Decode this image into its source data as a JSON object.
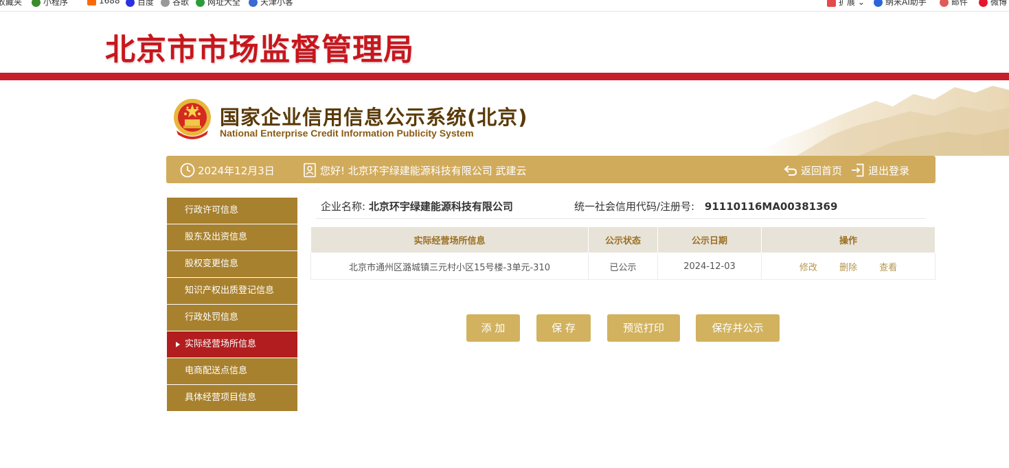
{
  "bookmarks": [
    {
      "label": "收藏夹",
      "color": "#ffffff"
    },
    {
      "label": "小程序",
      "color": "#3a8d2a"
    },
    {
      "label": "1688",
      "color": "#ff6a00"
    },
    {
      "label": "百度",
      "color": "#2932e1"
    },
    {
      "label": "谷歌",
      "color": "#888888"
    },
    {
      "label": "网址大全",
      "color": "#2a9d3a"
    },
    {
      "label": "天津小客",
      "color": "#3a6bd1"
    }
  ],
  "bookmarks_right": {
    "expand": "扩展",
    "ai": "纳米AI助手",
    "mail": "邮件",
    "weibo": "微博"
  },
  "banner": {
    "title": "北京市市场监督管理局"
  },
  "system": {
    "title": "国家企业信用信息公示系统(北京)",
    "subtitle": "National Enterprise Credit Information Publicity System"
  },
  "info_bar": {
    "date": "2024年12月3日",
    "greeting": "您好!  北京环宇绿建能源科技有限公司  武建云",
    "home": "返回首页",
    "logout": "退出登录"
  },
  "sidebar": {
    "items": [
      {
        "label": "行政许可信息"
      },
      {
        "label": "股东及出资信息"
      },
      {
        "label": "股权变更信息"
      },
      {
        "label": "知识产权出质登记信息"
      },
      {
        "label": "行政处罚信息"
      },
      {
        "label": "实际经营场所信息",
        "active": true
      },
      {
        "label": "电商配送点信息"
      },
      {
        "label": "具体经营项目信息"
      }
    ]
  },
  "company": {
    "name_label": "企业名称:",
    "name": "北京环宇绿建能源科技有限公司",
    "code_label": "统一社会信用代码/注册号:",
    "code": "91110116MA00381369"
  },
  "table": {
    "headers": [
      "实际经营场所信息",
      "公示状态",
      "公示日期",
      "操作"
    ],
    "rows": [
      {
        "address": "北京市通州区潞城镇三元村小区15号楼-3单元-310",
        "status": "已公示",
        "date": "2024-12-03",
        "ops": [
          "修改",
          "删除",
          "查看"
        ]
      }
    ]
  },
  "buttons": {
    "add": "添 加",
    "save": "保 存",
    "preview": "预览打印",
    "save_publish": "保存并公示"
  },
  "colors": {
    "brand_red": "#c8161d",
    "gold": "#d1ab5c",
    "sidebar": "#a8812e",
    "active": "#b21e1f"
  }
}
